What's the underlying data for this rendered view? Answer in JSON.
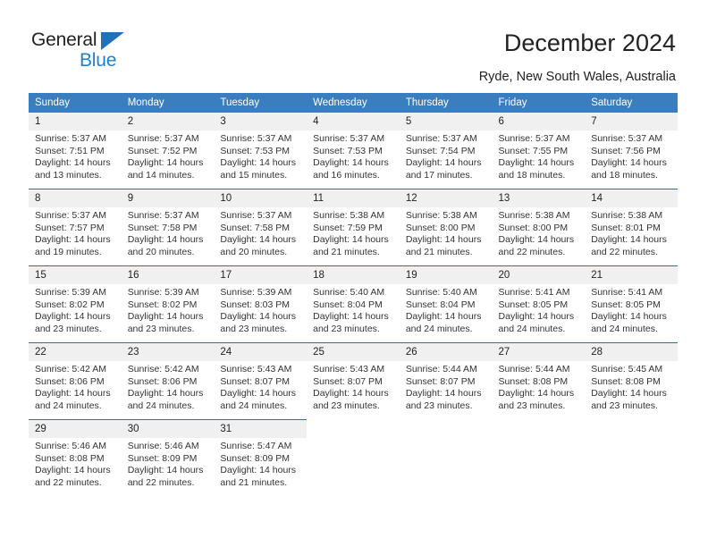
{
  "brand": {
    "name_part1": "General",
    "name_part2": "Blue",
    "triangle_color": "#1f71b8",
    "blue_color": "#1f82c8"
  },
  "header": {
    "title": "December 2024",
    "subtitle": "Ryde, New South Wales, Australia",
    "header_bg": "#3a7ebf",
    "grid_line_color": "#2f6ca8",
    "daynum_bg": "#f0f0f0"
  },
  "weekday_headers": [
    "Sunday",
    "Monday",
    "Tuesday",
    "Wednesday",
    "Thursday",
    "Friday",
    "Saturday"
  ],
  "weeks": [
    [
      {
        "day": "1",
        "sunrise": "Sunrise: 5:37 AM",
        "sunset": "Sunset: 7:51 PM",
        "daylight1": "Daylight: 14 hours",
        "daylight2": "and 13 minutes."
      },
      {
        "day": "2",
        "sunrise": "Sunrise: 5:37 AM",
        "sunset": "Sunset: 7:52 PM",
        "daylight1": "Daylight: 14 hours",
        "daylight2": "and 14 minutes."
      },
      {
        "day": "3",
        "sunrise": "Sunrise: 5:37 AM",
        "sunset": "Sunset: 7:53 PM",
        "daylight1": "Daylight: 14 hours",
        "daylight2": "and 15 minutes."
      },
      {
        "day": "4",
        "sunrise": "Sunrise: 5:37 AM",
        "sunset": "Sunset: 7:53 PM",
        "daylight1": "Daylight: 14 hours",
        "daylight2": "and 16 minutes."
      },
      {
        "day": "5",
        "sunrise": "Sunrise: 5:37 AM",
        "sunset": "Sunset: 7:54 PM",
        "daylight1": "Daylight: 14 hours",
        "daylight2": "and 17 minutes."
      },
      {
        "day": "6",
        "sunrise": "Sunrise: 5:37 AM",
        "sunset": "Sunset: 7:55 PM",
        "daylight1": "Daylight: 14 hours",
        "daylight2": "and 18 minutes."
      },
      {
        "day": "7",
        "sunrise": "Sunrise: 5:37 AM",
        "sunset": "Sunset: 7:56 PM",
        "daylight1": "Daylight: 14 hours",
        "daylight2": "and 18 minutes."
      }
    ],
    [
      {
        "day": "8",
        "sunrise": "Sunrise: 5:37 AM",
        "sunset": "Sunset: 7:57 PM",
        "daylight1": "Daylight: 14 hours",
        "daylight2": "and 19 minutes."
      },
      {
        "day": "9",
        "sunrise": "Sunrise: 5:37 AM",
        "sunset": "Sunset: 7:58 PM",
        "daylight1": "Daylight: 14 hours",
        "daylight2": "and 20 minutes."
      },
      {
        "day": "10",
        "sunrise": "Sunrise: 5:37 AM",
        "sunset": "Sunset: 7:58 PM",
        "daylight1": "Daylight: 14 hours",
        "daylight2": "and 20 minutes."
      },
      {
        "day": "11",
        "sunrise": "Sunrise: 5:38 AM",
        "sunset": "Sunset: 7:59 PM",
        "daylight1": "Daylight: 14 hours",
        "daylight2": "and 21 minutes."
      },
      {
        "day": "12",
        "sunrise": "Sunrise: 5:38 AM",
        "sunset": "Sunset: 8:00 PM",
        "daylight1": "Daylight: 14 hours",
        "daylight2": "and 21 minutes."
      },
      {
        "day": "13",
        "sunrise": "Sunrise: 5:38 AM",
        "sunset": "Sunset: 8:00 PM",
        "daylight1": "Daylight: 14 hours",
        "daylight2": "and 22 minutes."
      },
      {
        "day": "14",
        "sunrise": "Sunrise: 5:38 AM",
        "sunset": "Sunset: 8:01 PM",
        "daylight1": "Daylight: 14 hours",
        "daylight2": "and 22 minutes."
      }
    ],
    [
      {
        "day": "15",
        "sunrise": "Sunrise: 5:39 AM",
        "sunset": "Sunset: 8:02 PM",
        "daylight1": "Daylight: 14 hours",
        "daylight2": "and 23 minutes."
      },
      {
        "day": "16",
        "sunrise": "Sunrise: 5:39 AM",
        "sunset": "Sunset: 8:02 PM",
        "daylight1": "Daylight: 14 hours",
        "daylight2": "and 23 minutes."
      },
      {
        "day": "17",
        "sunrise": "Sunrise: 5:39 AM",
        "sunset": "Sunset: 8:03 PM",
        "daylight1": "Daylight: 14 hours",
        "daylight2": "and 23 minutes."
      },
      {
        "day": "18",
        "sunrise": "Sunrise: 5:40 AM",
        "sunset": "Sunset: 8:04 PM",
        "daylight1": "Daylight: 14 hours",
        "daylight2": "and 23 minutes."
      },
      {
        "day": "19",
        "sunrise": "Sunrise: 5:40 AM",
        "sunset": "Sunset: 8:04 PM",
        "daylight1": "Daylight: 14 hours",
        "daylight2": "and 24 minutes."
      },
      {
        "day": "20",
        "sunrise": "Sunrise: 5:41 AM",
        "sunset": "Sunset: 8:05 PM",
        "daylight1": "Daylight: 14 hours",
        "daylight2": "and 24 minutes."
      },
      {
        "day": "21",
        "sunrise": "Sunrise: 5:41 AM",
        "sunset": "Sunset: 8:05 PM",
        "daylight1": "Daylight: 14 hours",
        "daylight2": "and 24 minutes."
      }
    ],
    [
      {
        "day": "22",
        "sunrise": "Sunrise: 5:42 AM",
        "sunset": "Sunset: 8:06 PM",
        "daylight1": "Daylight: 14 hours",
        "daylight2": "and 24 minutes."
      },
      {
        "day": "23",
        "sunrise": "Sunrise: 5:42 AM",
        "sunset": "Sunset: 8:06 PM",
        "daylight1": "Daylight: 14 hours",
        "daylight2": "and 24 minutes."
      },
      {
        "day": "24",
        "sunrise": "Sunrise: 5:43 AM",
        "sunset": "Sunset: 8:07 PM",
        "daylight1": "Daylight: 14 hours",
        "daylight2": "and 24 minutes."
      },
      {
        "day": "25",
        "sunrise": "Sunrise: 5:43 AM",
        "sunset": "Sunset: 8:07 PM",
        "daylight1": "Daylight: 14 hours",
        "daylight2": "and 23 minutes."
      },
      {
        "day": "26",
        "sunrise": "Sunrise: 5:44 AM",
        "sunset": "Sunset: 8:07 PM",
        "daylight1": "Daylight: 14 hours",
        "daylight2": "and 23 minutes."
      },
      {
        "day": "27",
        "sunrise": "Sunrise: 5:44 AM",
        "sunset": "Sunset: 8:08 PM",
        "daylight1": "Daylight: 14 hours",
        "daylight2": "and 23 minutes."
      },
      {
        "day": "28",
        "sunrise": "Sunrise: 5:45 AM",
        "sunset": "Sunset: 8:08 PM",
        "daylight1": "Daylight: 14 hours",
        "daylight2": "and 23 minutes."
      }
    ],
    [
      {
        "day": "29",
        "sunrise": "Sunrise: 5:46 AM",
        "sunset": "Sunset: 8:08 PM",
        "daylight1": "Daylight: 14 hours",
        "daylight2": "and 22 minutes."
      },
      {
        "day": "30",
        "sunrise": "Sunrise: 5:46 AM",
        "sunset": "Sunset: 8:09 PM",
        "daylight1": "Daylight: 14 hours",
        "daylight2": "and 22 minutes."
      },
      {
        "day": "31",
        "sunrise": "Sunrise: 5:47 AM",
        "sunset": "Sunset: 8:09 PM",
        "daylight1": "Daylight: 14 hours",
        "daylight2": "and 21 minutes."
      },
      {
        "day": "",
        "sunrise": "",
        "sunset": "",
        "daylight1": "",
        "daylight2": "",
        "empty": true
      },
      {
        "day": "",
        "sunrise": "",
        "sunset": "",
        "daylight1": "",
        "daylight2": "",
        "empty": true
      },
      {
        "day": "",
        "sunrise": "",
        "sunset": "",
        "daylight1": "",
        "daylight2": "",
        "empty": true
      },
      {
        "day": "",
        "sunrise": "",
        "sunset": "",
        "daylight1": "",
        "daylight2": "",
        "empty": true
      }
    ]
  ]
}
